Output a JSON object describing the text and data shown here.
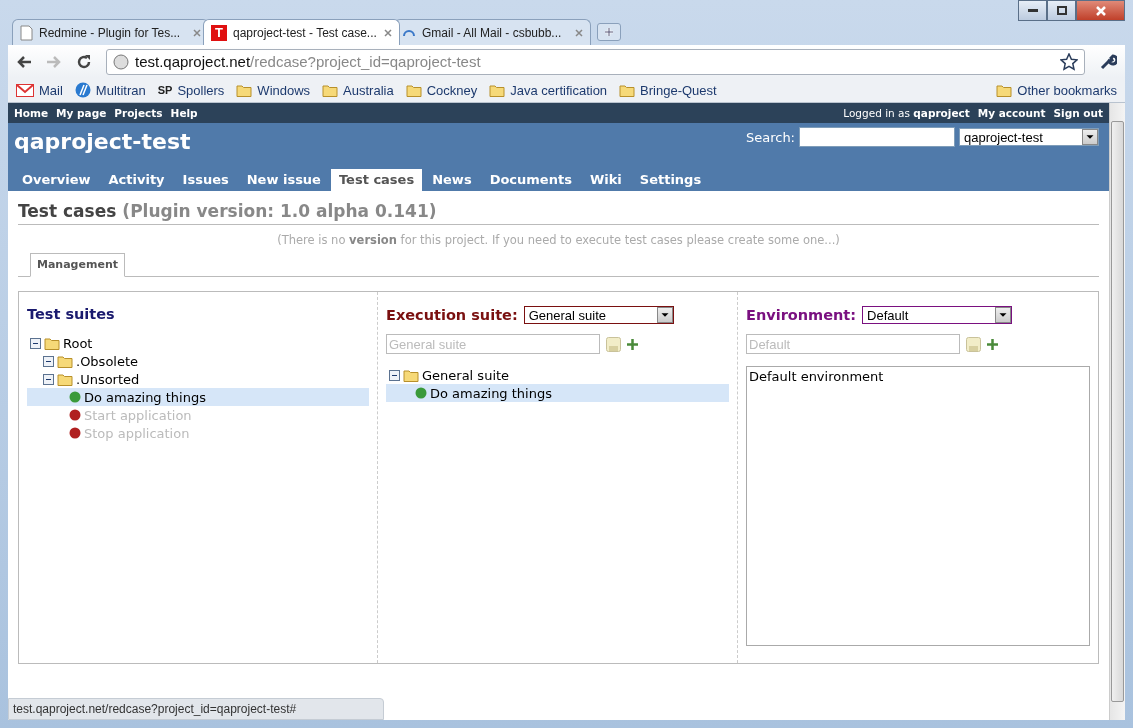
{
  "browser": {
    "tabs": [
      {
        "title": "Redmine - Plugin for Tes...",
        "selected": false,
        "kind": "page"
      },
      {
        "title": "qaproject-test - Test case...",
        "selected": true,
        "kind": "letter",
        "icon_text": "T"
      },
      {
        "title": "Gmail - All Mail - csbubb...",
        "selected": false,
        "kind": "loading"
      }
    ],
    "address": {
      "host": "test.qaproject.net",
      "path": "/redcase?project_id=qaproject-test"
    },
    "bookmarks": [
      {
        "label": "Mail",
        "kind": "mail"
      },
      {
        "label": "Multitran",
        "kind": "globe"
      },
      {
        "label": "Spollers",
        "kind": "letters",
        "icon_text": "SP"
      },
      {
        "label": "Windows",
        "kind": "folder"
      },
      {
        "label": "Australia",
        "kind": "folder"
      },
      {
        "label": "Cockney",
        "kind": "folder"
      },
      {
        "label": "Java certification",
        "kind": "folder"
      },
      {
        "label": "Bringe-Quest",
        "kind": "folder"
      }
    ],
    "other_bookmarks": "Other bookmarks"
  },
  "top_menu": [
    "Home",
    "My page",
    "Projects",
    "Help"
  ],
  "account": {
    "logged_in": "Logged in as **qaproject**",
    "links": [
      "My account",
      "Sign out"
    ]
  },
  "project_title": "qaproject-test",
  "search": {
    "label": "Search:",
    "project": "qaproject-test"
  },
  "main_tabs": [
    {
      "label": "Overview",
      "selected": false
    },
    {
      "label": "Activity",
      "selected": false
    },
    {
      "label": "Issues",
      "selected": false
    },
    {
      "label": "New issue",
      "selected": false
    },
    {
      "label": "Test cases",
      "selected": true
    },
    {
      "label": "News",
      "selected": false
    },
    {
      "label": "Documents",
      "selected": false
    },
    {
      "label": "Wiki",
      "selected": false
    },
    {
      "label": "Settings",
      "selected": false
    }
  ],
  "heading": {
    "title": "Test cases",
    "subtitle": "(Plugin version: 1.0 alpha 0.141)"
  },
  "notice": "(There is no **version** for this project. If you need to execute test cases please create some one...)",
  "sub_tabs": [
    {
      "label": "Management",
      "selected": true
    }
  ],
  "test_suites": {
    "title": "Test suites",
    "tree": [
      {
        "label": "Root",
        "kind": "folder",
        "expanded": true,
        "children": [
          {
            "label": ".Obsolete",
            "kind": "folder",
            "expanded": true
          },
          {
            "label": ".Unsorted",
            "kind": "folder",
            "expanded": true,
            "children": [
              {
                "label": "Do amazing things",
                "kind": "case",
                "color": "#3a9a3a",
                "selected": true,
                "disabled": false
              },
              {
                "label": "Start application",
                "kind": "case",
                "color": "#b02020",
                "selected": false,
                "disabled": true
              },
              {
                "label": "Stop application",
                "kind": "case",
                "color": "#b02020",
                "selected": false,
                "disabled": true
              }
            ]
          }
        ]
      }
    ]
  },
  "execution": {
    "label": "Execution suite:",
    "select": "General suite",
    "name_placeholder": "General suite",
    "tree": [
      {
        "label": "General suite",
        "kind": "folder",
        "expanded": true,
        "children": [
          {
            "label": "Do amazing things",
            "kind": "case",
            "color": "#3a9a3a",
            "selected": true,
            "disabled": false
          }
        ]
      }
    ]
  },
  "environment": {
    "label": "Environment:",
    "select": "Default",
    "name_placeholder": "Default",
    "description": "Default environment"
  },
  "status_bar": "test.qaproject.net/redcase?project_id=qaproject-test#"
}
